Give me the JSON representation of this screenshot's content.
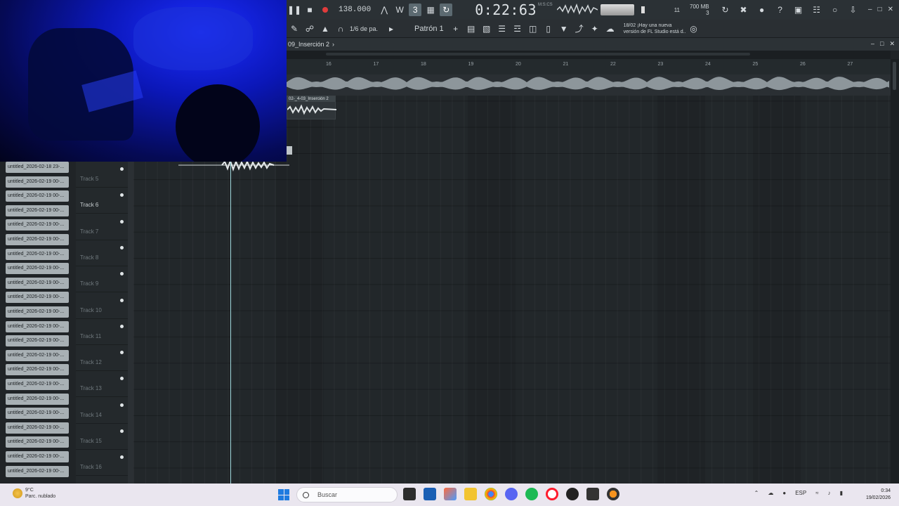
{
  "toolbar": {
    "tempo": "138.000",
    "time": "0:22:63",
    "time_unit": "M:S:CS",
    "cpu_value": "11",
    "mem_value": "700 MB",
    "mem_voices": "3"
  },
  "toolbar2": {
    "snap": "1/6 de pa.",
    "pattern": "Patrón 1",
    "news_line1": "18/02  ¡Hay una nueva",
    "news_line2": "versión de FL Studio está d.."
  },
  "playlist": {
    "title": "09_Inserción 2",
    "ruler_marks": [
      "16",
      "17",
      "18",
      "19",
      "20",
      "21",
      "22",
      "23",
      "24",
      "25",
      "26",
      "27"
    ],
    "clip_title": "02-_4-03_Inserción 2"
  },
  "clips": [
    "untitled_2026-02-18 23-...",
    "untitled_2026-02-19 00-...",
    "untitled_2026-02-19 00-...",
    "untitled_2026-02-19 00-...",
    "untitled_2026-02-19 00-...",
    "untitled_2026-02-19 00-...",
    "untitled_2026-02-19 00-...",
    "untitled_2026-02-19 00-...",
    "untitled_2026-02-19 00-...",
    "untitled_2026-02-19 00-...",
    "untitled_2026-02-19 00-...",
    "untitled_2026-02-19 00-...",
    "untitled_2026-02-19 00-...",
    "untitled_2026-02-19 00-...",
    "untitled_2026-02-19 00-...",
    "untitled_2026-02-19 00-...",
    "untitled_2026-02-19 00-...",
    "untitled_2026-02-19 00-...",
    "untitled_2026-02-19 00-...",
    "untitled_2026-02-19 00-...",
    "untitled_2026-02-19 00-...",
    "untitled_2026-02-19 00-..."
  ],
  "tracks": [
    "Track 5",
    "Track 6",
    "Track 7",
    "Track 8",
    "Track 9",
    "Track 10",
    "Track 11",
    "Track 12",
    "Track 13",
    "Track 14",
    "Track 15",
    "Track 16"
  ],
  "taskbar": {
    "temp": "9°C",
    "weather": "Parc. nublado",
    "search_placeholder": "Buscar",
    "lang": "ESP",
    "time": "0:34",
    "date": "19/02/2026"
  },
  "colors": {
    "accent": "#9fd8dc",
    "record": "#e03c3c",
    "start": "#1f7be0"
  }
}
